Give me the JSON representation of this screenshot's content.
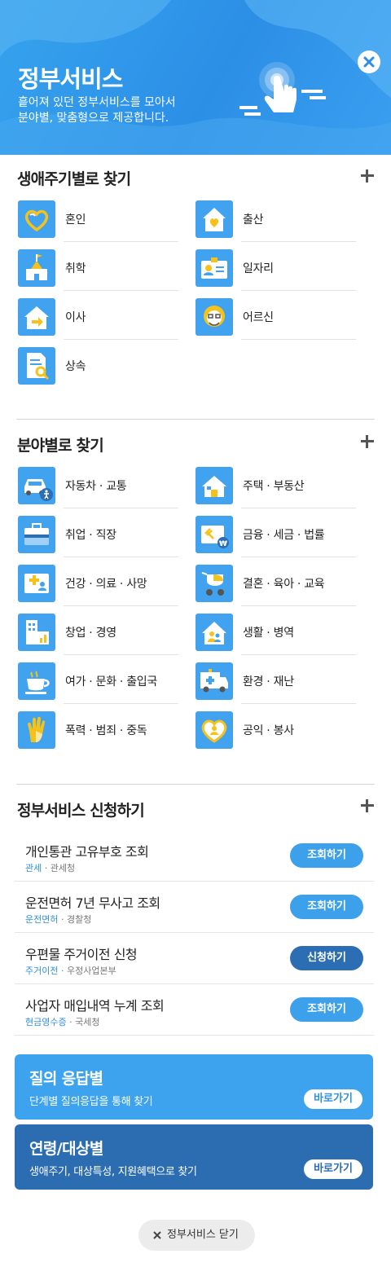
{
  "header": {
    "title": "정부서비스",
    "desc_line1": "흩어져 있던 정부서비스를 모아서",
    "desc_line2": "분야별, 맞춤형으로 제공합니다."
  },
  "lifecycle": {
    "title": "생애주기별로 찾기",
    "items": [
      {
        "label": "혼인",
        "icon": "heart-ring-icon"
      },
      {
        "label": "출산",
        "icon": "house-heart-icon"
      },
      {
        "label": "취학",
        "icon": "school-icon"
      },
      {
        "label": "일자리",
        "icon": "id-card-icon"
      },
      {
        "label": "이사",
        "icon": "house-move-icon"
      },
      {
        "label": "어르신",
        "icon": "elder-icon"
      },
      {
        "label": "상속",
        "icon": "document-search-icon"
      }
    ]
  },
  "field": {
    "title": "분야별로 찾기",
    "items": [
      {
        "label": "자동차 · 교통",
        "icon": "car-icon"
      },
      {
        "label": "주택 · 부동산",
        "icon": "house-icon"
      },
      {
        "label": "취업 · 직장",
        "icon": "briefcase-icon"
      },
      {
        "label": "금융 · 세금 · 법률",
        "icon": "gavel-won-icon"
      },
      {
        "label": "건강 · 의료 · 사망",
        "icon": "medical-card-icon"
      },
      {
        "label": "결혼 · 육아 · 교육",
        "icon": "stroller-icon"
      },
      {
        "label": "창업 · 경영",
        "icon": "building-chart-icon"
      },
      {
        "label": "생활 · 병역",
        "icon": "house-people-icon"
      },
      {
        "label": "여가 · 문화 · 출입국",
        "icon": "coffee-cup-icon"
      },
      {
        "label": "환경 · 재난",
        "icon": "ambulance-icon"
      },
      {
        "label": "폭력 · 범죄 · 중독",
        "icon": "stop-hand-icon"
      },
      {
        "label": "공익 · 봉사",
        "icon": "heart-person-icon"
      }
    ]
  },
  "apply": {
    "title": "정부서비스 신청하기",
    "rows": [
      {
        "title": "개인통관 고유부호 조회",
        "category": "관세",
        "agency": "관세청",
        "button": "조회하기",
        "variant": "light"
      },
      {
        "title": "운전면허 7년 무사고 조회",
        "category": "운전면허",
        "agency": "경찰청",
        "button": "조회하기",
        "variant": "light"
      },
      {
        "title": "우편물 주거이전 신청",
        "category": "주거이전",
        "agency": "우정사업본부",
        "button": "신청하기",
        "variant": "dark"
      },
      {
        "title": "사업자 매입내역 누계 조회",
        "category": "현금영수증",
        "agency": "국세청",
        "button": "조회하기",
        "variant": "light"
      }
    ]
  },
  "banners": [
    {
      "title": "질의 응답별",
      "desc": "단계별 질의응답을 통해 찾기",
      "button": "바로가기",
      "variant": "light"
    },
    {
      "title": "연령/대상별",
      "desc": "생애주기, 대상특성, 지원혜택으로 찾기",
      "button": "바로가기",
      "variant": "dark"
    }
  ],
  "footer": {
    "close_label": "정부서비스 닫기"
  },
  "separator": " · ",
  "colors": {
    "primary": "#41a2ef",
    "dark_button": "#2c6eb3",
    "icon_accent": "#f5c21b",
    "header": "#2c8fe6"
  }
}
